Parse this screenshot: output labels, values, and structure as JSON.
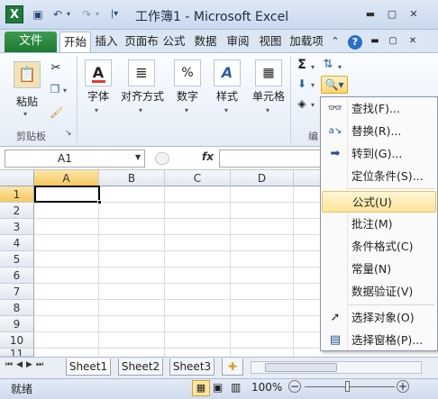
{
  "title_bar": {
    "title": "工作簿1 - Microsoft Excel",
    "app_icon": "X"
  },
  "tabs": {
    "file": "文件",
    "items": [
      "开始",
      "插入",
      "页面布",
      "公式",
      "数据",
      "审阅",
      "视图",
      "加载项"
    ]
  },
  "ribbon": {
    "paste": "粘贴",
    "clipboard_group": "剪贴板",
    "font": "字体",
    "align": "对齐方式",
    "number": "数字",
    "styles": "样式",
    "cells": "单元格",
    "edit_group": "编"
  },
  "formula_bar": {
    "name_box": "A1",
    "fx": "fx"
  },
  "grid": {
    "columns": [
      "A",
      "B",
      "C",
      "D"
    ],
    "rows": [
      "1",
      "2",
      "3",
      "4",
      "5",
      "6",
      "7",
      "8",
      "9",
      "10",
      "11"
    ]
  },
  "sheets": [
    "Sheet1",
    "Sheet2",
    "Sheet3"
  ],
  "status": {
    "ready": "就绪",
    "zoom": "100%"
  },
  "menu": {
    "items": [
      {
        "label": "查找(F)...",
        "icon": "binoculars-icon"
      },
      {
        "label": "替换(R)...",
        "icon": "replace-icon"
      },
      {
        "label": "转到(G)...",
        "icon": "arrow-right-icon"
      },
      {
        "label": "定位条件(S)...",
        "icon": ""
      },
      {
        "label": "公式(U)",
        "icon": ""
      },
      {
        "label": "批注(M)",
        "icon": ""
      },
      {
        "label": "条件格式(C)",
        "icon": ""
      },
      {
        "label": "常量(N)",
        "icon": ""
      },
      {
        "label": "数据验证(V)",
        "icon": ""
      },
      {
        "label": "选择对象(O)",
        "icon": "cursor-icon"
      },
      {
        "label": "选择窗格(P)...",
        "icon": "pane-icon"
      }
    ],
    "highlighted": "公式(U)"
  }
}
